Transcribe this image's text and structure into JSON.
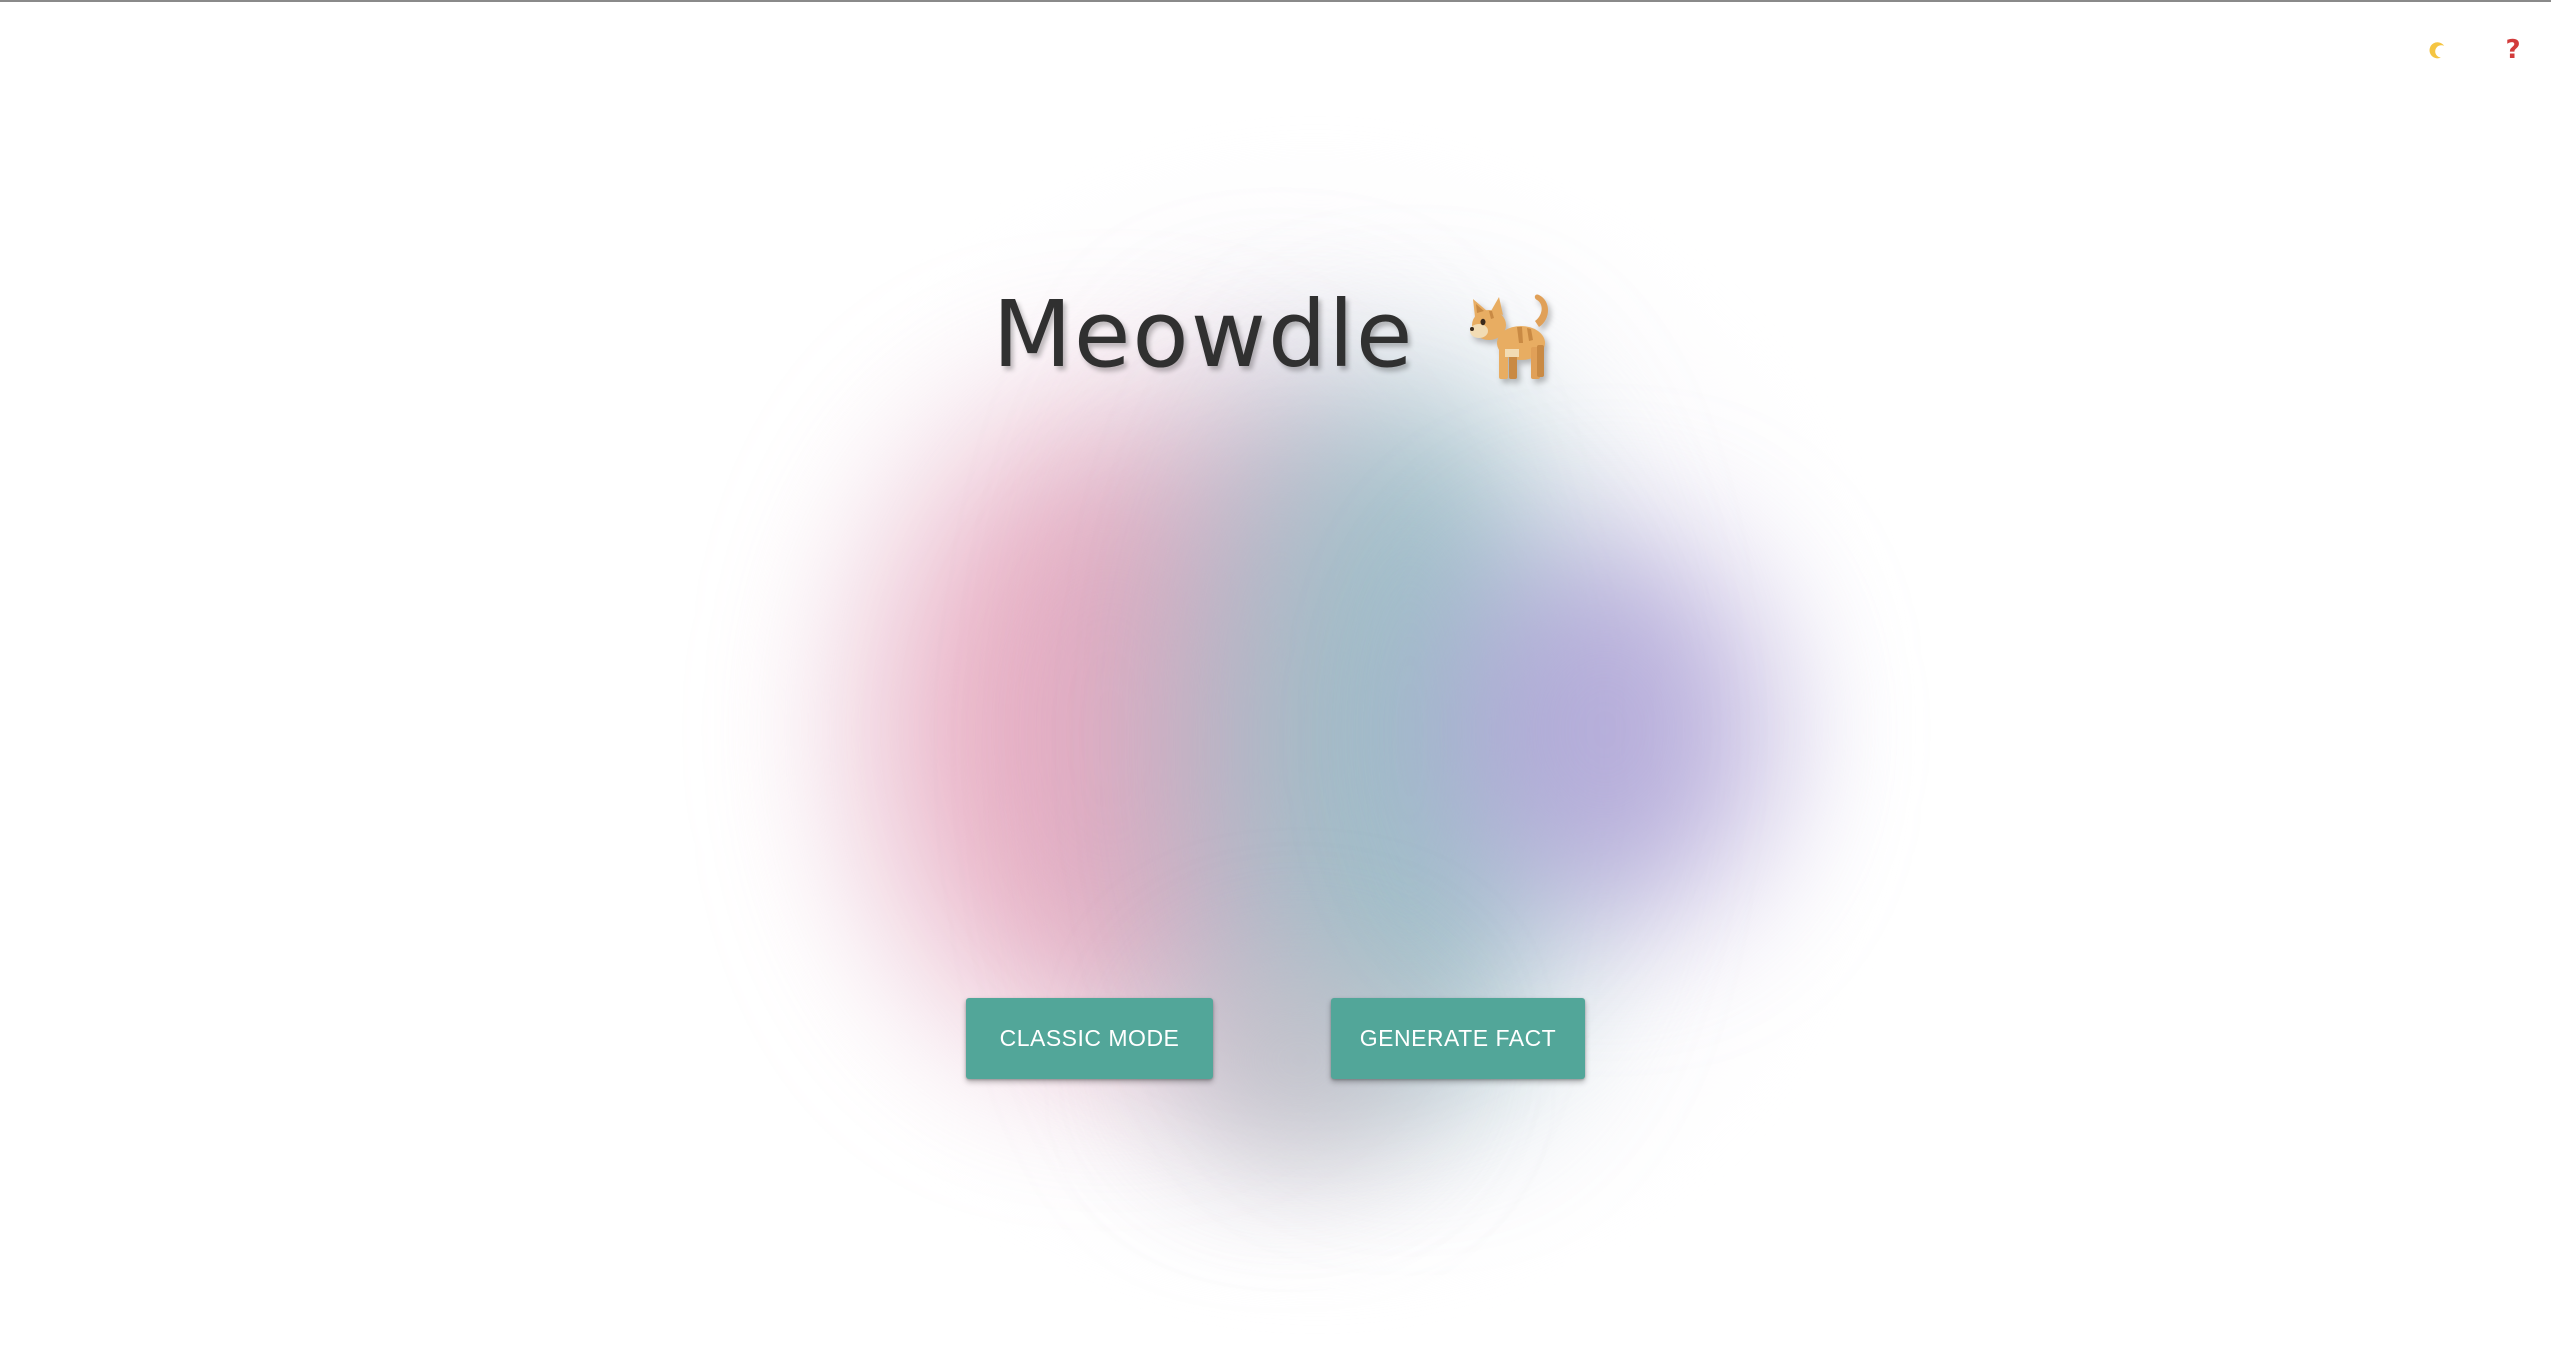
{
  "header": {
    "dark_mode_icon": "crescent-moon-icon",
    "help_icon": "question-mark-icon",
    "help_glyph": "?"
  },
  "main": {
    "title": "Meowdle",
    "title_icon": "cat-icon",
    "buttons": {
      "classic_label": "CLASSIC MODE",
      "fact_label": "GENERATE FACT"
    }
  },
  "colors": {
    "button_bg": "#52a699",
    "button_text": "#ffffff",
    "title_text": "#303030",
    "help_icon": "#d23b3b",
    "moon_icon": "#f5c542",
    "blob_pink": "#e4a0b9",
    "blob_teal": "#96bcc6",
    "blob_purple": "#aca0d6"
  }
}
